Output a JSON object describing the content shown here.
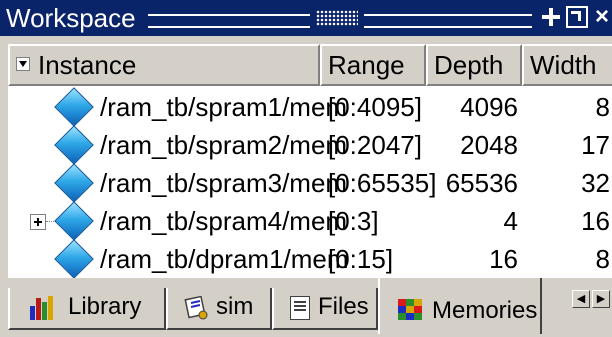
{
  "window": {
    "title": "Workspace"
  },
  "columns": {
    "instance": "Instance",
    "range": "Range",
    "depth": "Depth",
    "width": "Width"
  },
  "rows": [
    {
      "instance": "/ram_tb/spram1/mem",
      "range": "[0:4095]",
      "depth": "4096",
      "width": "8",
      "expandable": false
    },
    {
      "instance": "/ram_tb/spram2/mem",
      "range": "[0:2047]",
      "depth": "2048",
      "width": "17",
      "expandable": false
    },
    {
      "instance": "/ram_tb/spram3/mem",
      "range": "[0:65535]",
      "depth": "65536",
      "width": "32",
      "expandable": false
    },
    {
      "instance": "/ram_tb/spram4/mem",
      "range": "[0:3]",
      "depth": "4",
      "width": "16",
      "expandable": true
    },
    {
      "instance": "/ram_tb/dpram1/mem",
      "range": "[0:15]",
      "depth": "16",
      "width": "8",
      "expandable": false
    }
  ],
  "tabs": [
    {
      "label": "Library",
      "icon": "library-icon",
      "active": false
    },
    {
      "label": "sim",
      "icon": "sim-icon",
      "active": false
    },
    {
      "label": "Files",
      "icon": "files-icon",
      "active": false
    },
    {
      "label": "Memories",
      "icon": "memories-icon",
      "active": true
    }
  ],
  "colors": {
    "titlebar": "#0a246a",
    "panel": "#d4d0c8",
    "list_bg": "#ffffff"
  }
}
